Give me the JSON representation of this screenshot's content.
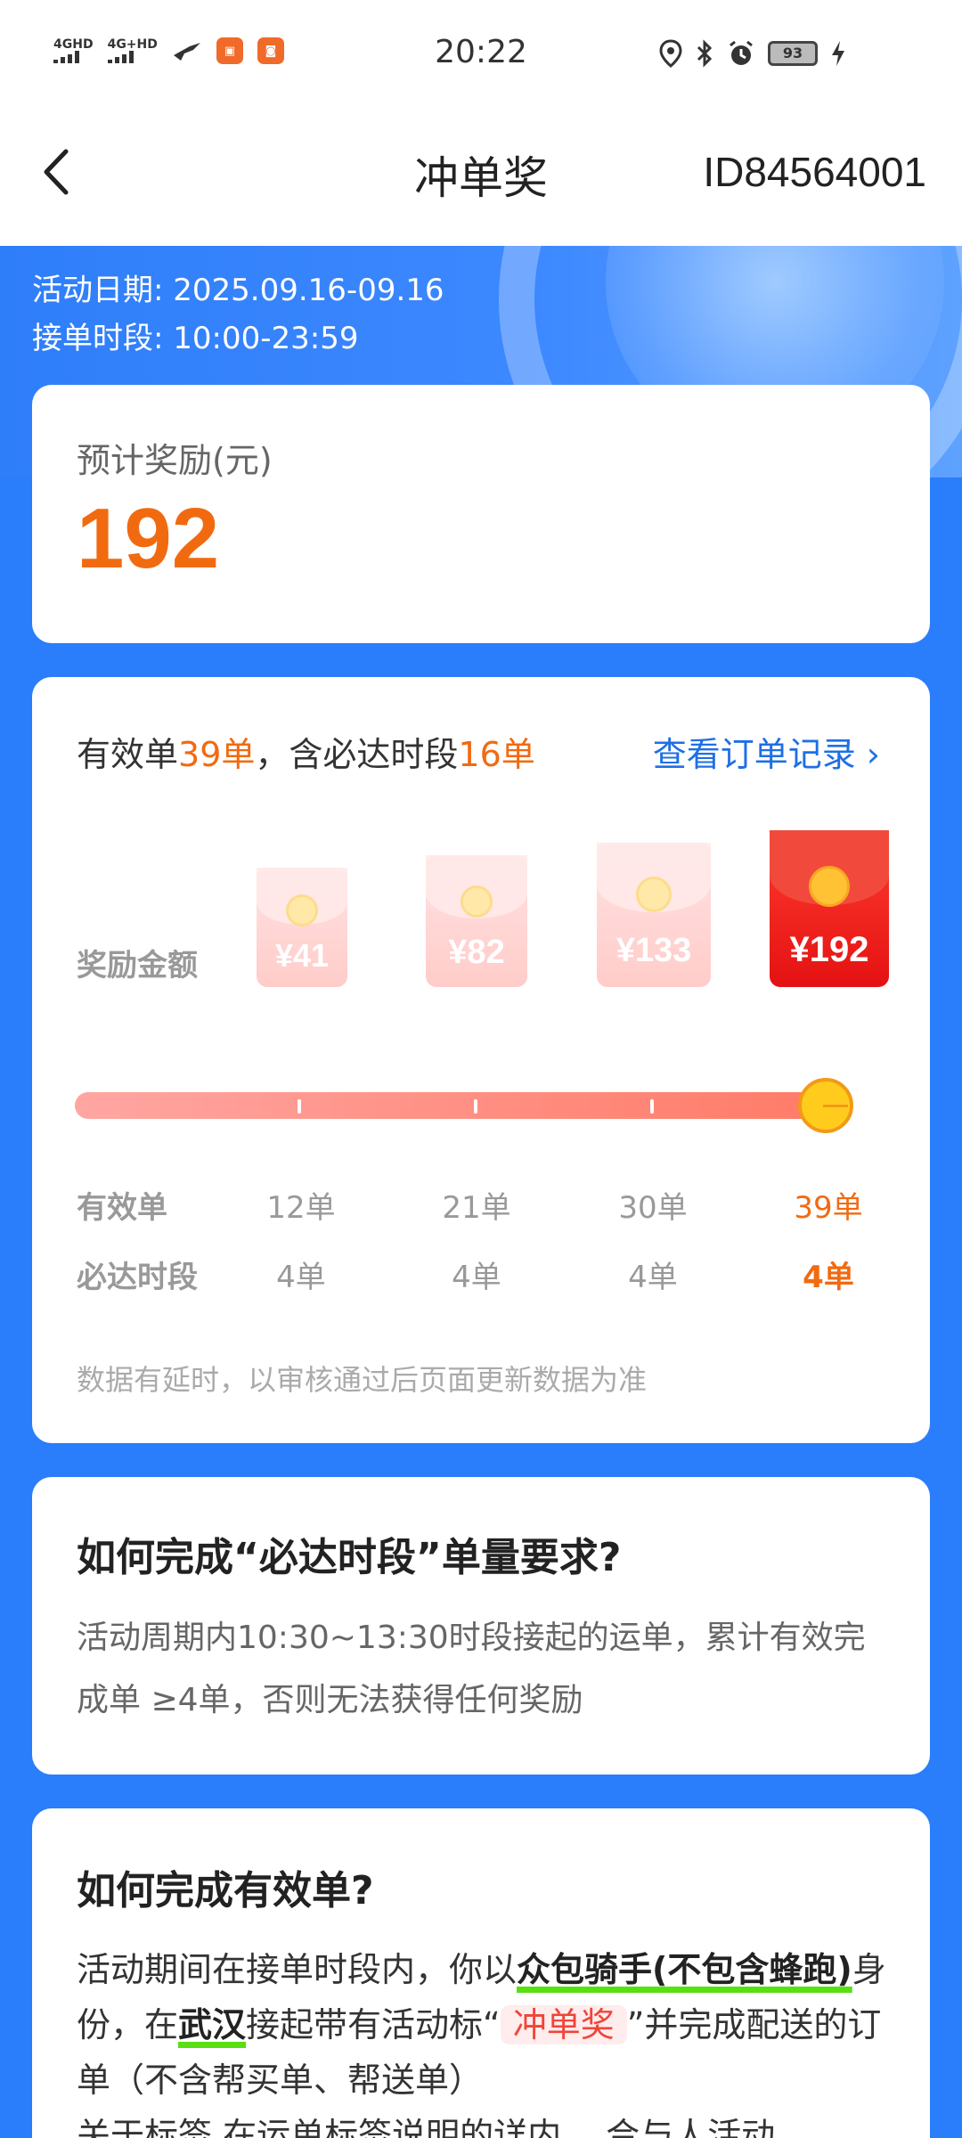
{
  "status_bar": {
    "signal1": "4GHD",
    "signal2": "4G+HD",
    "app_icon1": "app",
    "app_icon2": "app",
    "time": "20:22",
    "battery": "93"
  },
  "nav": {
    "title": "冲单奖",
    "id_text": "ID84564001"
  },
  "activity": {
    "date_label": "活动日期: 2025.09.16-09.16",
    "period_label": "接单时段: 10:00-23:59"
  },
  "reward": {
    "label": "预计奖励(元)",
    "value": "192"
  },
  "progress": {
    "summary_prefix": "有效单",
    "valid_count": "39单",
    "summary_mid": "，含必达时段",
    "required_count": "16单",
    "link_text": "查看订单记录 ›",
    "amount_label": "奖励金额",
    "valid_label": "有效单",
    "required_label": "必达时段",
    "progress_fraction": 1.0,
    "tiers": [
      {
        "amount": "¥41",
        "valid": "12单",
        "required": "4单"
      },
      {
        "amount": "¥82",
        "valid": "21单",
        "required": "4单"
      },
      {
        "amount": "¥133",
        "valid": "30单",
        "required": "4单"
      },
      {
        "amount": "¥192",
        "valid": "39单",
        "required": "4单"
      }
    ],
    "note": "数据有延时，以审核通过后页面更新数据为准"
  },
  "section1": {
    "title": "如何完成“必达时段”单量要求?",
    "body": "活动周期内10:30~13:30时段接起的运单，累计有效完成单 ≥4单，否则无法获得任何奖励"
  },
  "section2": {
    "title": "如何完成有效单?",
    "p1": "活动期间在接单时段内，你以",
    "p2": "众包骑手(不包含蜂跑)",
    "p3": "身份，在",
    "p4": "武汉",
    "p5": "接起带有活动标“",
    "tag": "冲单奖",
    "p6": "”并完成配送的订单（不含帮买单、帮送单）",
    "faded": "关于标签 在运单标签说明的详内… 合与人活动"
  },
  "colors": {
    "brand_blue": "#2a7dfb",
    "accent_orange": "#f26a10",
    "link_blue": "#1f6fe5",
    "highlight_green": "#58e012"
  }
}
